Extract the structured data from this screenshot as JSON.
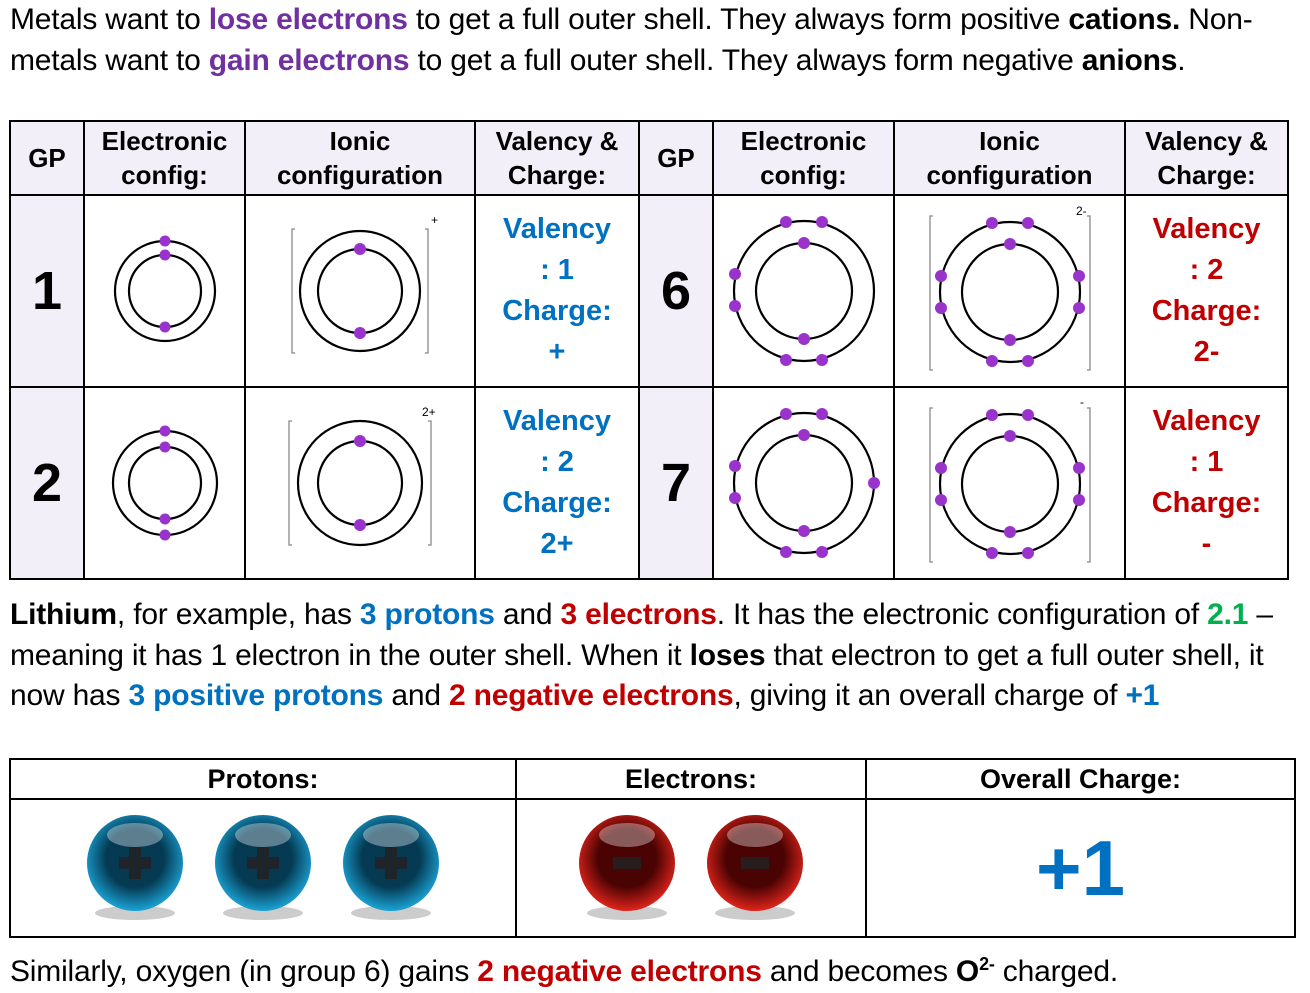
{
  "intro": {
    "s1": "Metals want to ",
    "s2": "lose electrons",
    "s3": " to get a full outer shell. They always form positive ",
    "s4": "cations.",
    "s5": " Non-metals want to ",
    "s6": "gain electrons",
    "s7": " to get a full outer shell. They always form negative ",
    "s8": "anions",
    "s9": "."
  },
  "ion_table": {
    "headers": {
      "gp": "GP",
      "electronic": "Electronic config:",
      "ionic": "Ionic configuration",
      "valency": "Valency & Charge:"
    },
    "rows": [
      {
        "left": {
          "gp": "1",
          "ion_charge": "+",
          "val1": "Valency",
          "val2": ": 1",
          "val3": "Charge:",
          "val4": "+"
        },
        "right": {
          "gp": "6",
          "ion_charge": "2-",
          "val1": "Valency",
          "val2": ": 2",
          "val3": "Charge:",
          "val4": "2-"
        }
      },
      {
        "left": {
          "gp": "2",
          "ion_charge": "2+",
          "val1": "Valency",
          "val2": ": 2",
          "val3": "Charge:",
          "val4": "2+"
        },
        "right": {
          "gp": "7",
          "ion_charge": "-",
          "val1": "Valency",
          "val2": ": 1",
          "val3": "Charge:",
          "val4": "-"
        }
      }
    ]
  },
  "lithium": {
    "s1": "Lithium",
    "s2": ", for example, has ",
    "s3": "3 protons",
    "s4": " and ",
    "s5": "3 electrons",
    "s6": ". It has the electronic configuration of ",
    "s7": "2.1",
    "s8": " – meaning it has 1 electron in the outer shell. When it ",
    "s9": "loses",
    "s10": " that electron to get a full outer shell, it now has ",
    "s11": "3 positive protons",
    "s12": " and ",
    "s13": "2 negative electrons",
    "s14": ", giving it an overall charge of ",
    "s15": "+1"
  },
  "charge_table": {
    "protons_label": "Protons:",
    "electrons_label": "Electrons:",
    "overall_label": "Overall Charge:",
    "protons_count": 3,
    "electrons_count": 2,
    "overall_value": "+1"
  },
  "oxygen": {
    "s1": "Similarly, oxygen (in group 6) gains ",
    "s2": "2 negative electrons",
    "s3": " and becomes ",
    "s4": "O",
    "s5": "2-",
    "s6": " charged."
  },
  "colors": {
    "purple": "#7030a0",
    "blue": "#0070c0",
    "red": "#c00000",
    "green": "#00b050",
    "electron": "#9933cc"
  }
}
